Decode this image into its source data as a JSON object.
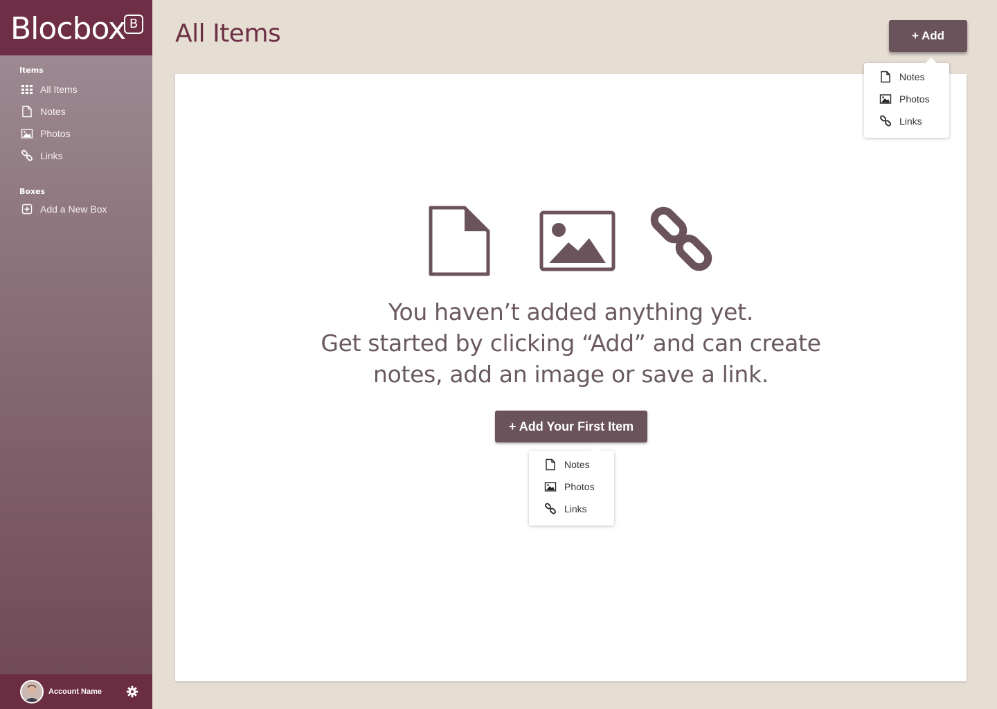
{
  "brand": {
    "name": "Blocbox",
    "badge": "B"
  },
  "sidebar": {
    "items_section_label": "Items",
    "items": [
      {
        "label": "All Items",
        "icon": "grid-icon"
      },
      {
        "label": "Notes",
        "icon": "file-icon"
      },
      {
        "label": "Photos",
        "icon": "image-icon"
      },
      {
        "label": "Links",
        "icon": "link-icon"
      }
    ],
    "boxes_section_label": "Boxes",
    "boxes": [
      {
        "label": "Add a New Box",
        "icon": "plus-square-icon"
      }
    ],
    "account": {
      "name": "Account Name",
      "icon": "gear-icon"
    }
  },
  "header": {
    "title": "All Items",
    "add_label": "+ Add"
  },
  "header_dropdown": {
    "items": [
      {
        "label": "Notes",
        "icon": "file-icon"
      },
      {
        "label": "Photos",
        "icon": "image-icon"
      },
      {
        "label": "Links",
        "icon": "link-icon"
      }
    ]
  },
  "empty_state": {
    "line1": "You haven’t added anything yet.",
    "line2": "Get started by clicking “Add”  and can create",
    "line3": "notes, add an image or save a link.",
    "button_label": "+ Add Your First Item",
    "icons": [
      "file-icon",
      "image-icon",
      "link-icon"
    ]
  },
  "first_item_dropdown": {
    "items": [
      {
        "label": "Notes",
        "icon": "file-icon"
      },
      {
        "label": "Photos",
        "icon": "image-icon"
      },
      {
        "label": "Links",
        "icon": "link-icon"
      }
    ]
  },
  "colors": {
    "accent": "#6e2e45",
    "button": "#6b535c",
    "background": "#e6ddd3"
  }
}
